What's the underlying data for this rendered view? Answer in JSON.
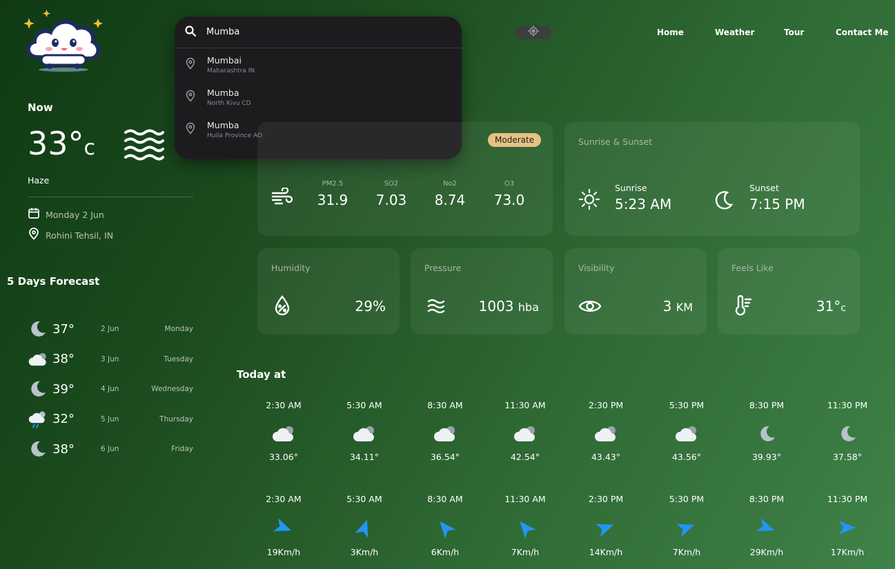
{
  "search": {
    "query": "Mumba",
    "suggestions": [
      {
        "name": "Mumbai",
        "sub": "Maharashtra IN"
      },
      {
        "name": "Mumba",
        "sub": "North Kivu CD"
      },
      {
        "name": "Mumba",
        "sub": "Huila Province AO"
      }
    ]
  },
  "nav": {
    "home": "Home",
    "weather": "Weather",
    "tour": "Tour",
    "contact": "Contact Me"
  },
  "current": {
    "heading": "Now",
    "temp": "33°",
    "unit": "c",
    "condition": "Haze",
    "date": "Monday 2 Jun",
    "location": "Rohini Tehsil, IN"
  },
  "forecast": {
    "heading": "5 Days Forecast",
    "days": [
      {
        "icon": "moon-icon",
        "temp": "37°",
        "date": "2 Jun",
        "day": "Monday"
      },
      {
        "icon": "cloud-icon",
        "temp": "38°",
        "date": "3 Jun",
        "day": "Tuesday"
      },
      {
        "icon": "moon-icon",
        "temp": "39°",
        "date": "4 Jun",
        "day": "Wednesday"
      },
      {
        "icon": "rain-icon",
        "temp": "32°",
        "date": "5 Jun",
        "day": "Thursday"
      },
      {
        "icon": "moon-icon",
        "temp": "38°",
        "date": "6 Jun",
        "day": "Friday"
      }
    ]
  },
  "air_quality": {
    "badge": "Moderate",
    "items": [
      {
        "label": "PM2.5",
        "value": "31.9"
      },
      {
        "label": "SO2",
        "value": "7.03"
      },
      {
        "label": "No2",
        "value": "8.74"
      },
      {
        "label": "O3",
        "value": "73.0"
      }
    ]
  },
  "sun": {
    "title": "Sunrise & Sunset",
    "sunrise_label": "Sunrise",
    "sunrise": "5:23 AM",
    "sunset_label": "Sunset",
    "sunset": "7:15 PM"
  },
  "stats": {
    "humidity": {
      "title": "Humidity",
      "value": "29%"
    },
    "pressure": {
      "title": "Pressure",
      "value": "1003",
      "unit": "hba"
    },
    "visibility": {
      "title": "Visibility",
      "value": "3",
      "unit": "KM"
    },
    "feels_like": {
      "title": "Feels Like",
      "value": "31°",
      "unit": "c"
    }
  },
  "today": {
    "heading": "Today at",
    "temps": [
      {
        "time": "2:30 AM",
        "icon": "cloud-icon",
        "value": "33.06°"
      },
      {
        "time": "5:30 AM",
        "icon": "cloud-icon",
        "value": "34.11°"
      },
      {
        "time": "8:30 AM",
        "icon": "cloud-icon",
        "value": "36.54°"
      },
      {
        "time": "11:30 AM",
        "icon": "cloud-icon",
        "value": "42.54°"
      },
      {
        "time": "2:30 PM",
        "icon": "cloud-icon",
        "value": "43.43°"
      },
      {
        "time": "5:30 PM",
        "icon": "cloud-icon",
        "value": "43.56°"
      },
      {
        "time": "8:30 PM",
        "icon": "moon-icon",
        "value": "39.93°"
      },
      {
        "time": "11:30 PM",
        "icon": "moon-icon",
        "value": "37.58°"
      }
    ],
    "winds": [
      {
        "time": "2:30 AM",
        "value": "19Km/h"
      },
      {
        "time": "5:30 AM",
        "value": "3Km/h"
      },
      {
        "time": "8:30 AM",
        "value": "6Km/h"
      },
      {
        "time": "11:30 AM",
        "value": "7Km/h"
      },
      {
        "time": "2:30 PM",
        "value": "14Km/h"
      },
      {
        "time": "5:30 PM",
        "value": "7Km/h"
      },
      {
        "time": "8:30 PM",
        "value": "29Km/h"
      },
      {
        "time": "11:30 PM",
        "value": "17Km/h"
      }
    ]
  },
  "colors": {
    "accent": "#2196f3",
    "badge": "#e8c183",
    "icon_grey": "#b9c2cc"
  }
}
